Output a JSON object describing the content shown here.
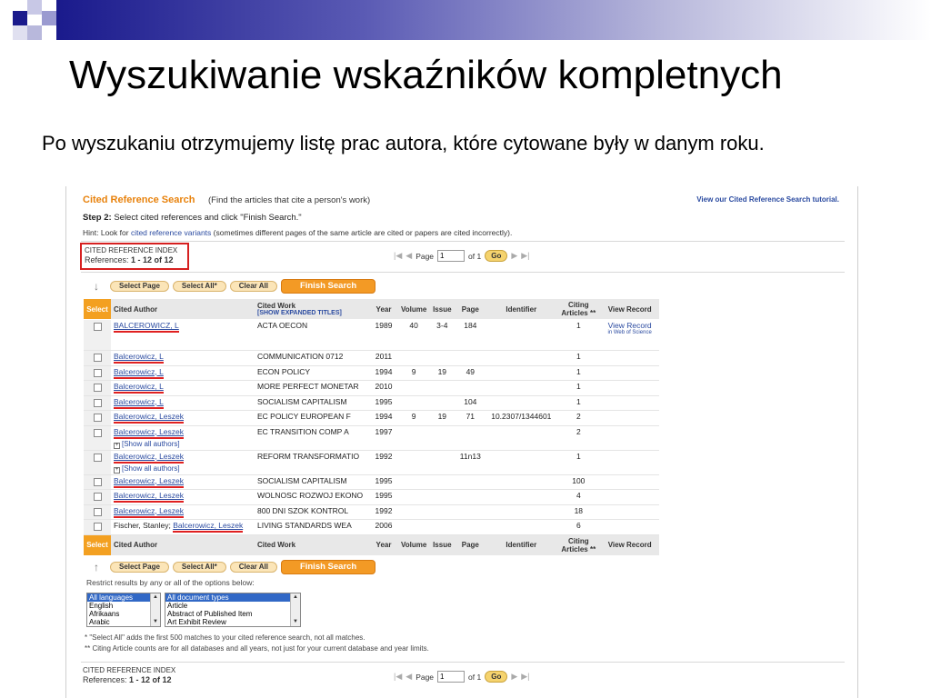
{
  "slide": {
    "title": "Wyszukiwanie wskaźników kompletnych",
    "text": "Po wyszukaniu otrzymujemy listę prac autora, które cytowane były w danym roku."
  },
  "colors": {
    "accent": "#f39a25",
    "highlight": "#e02020",
    "link": "#2a4aa0",
    "banner": "#1a1a8c"
  },
  "header": {
    "title": "Cited Reference Search",
    "subtitle": "(Find the articles that cite a person's work)",
    "tutorial": "View our Cited Reference Search tutorial.",
    "step_label": "Step 2:",
    "step_text": "Select cited references and click \"Finish Search.\"",
    "hint_prefix": "Hint: Look for",
    "hint_link": "cited reference variants",
    "hint_suffix": "(sometimes different pages of the same article are cited or papers are cited incorrectly)."
  },
  "index": {
    "label": "CITED REFERENCE INDEX",
    "refs_label": "References:",
    "refs_value": "1 - 12 of   12"
  },
  "pager": {
    "page_label": "Page",
    "page_value": "1",
    "of_label": "of 1",
    "go": "Go",
    "first": "|◀",
    "prev": "◀",
    "next": "▶",
    "last": "▶|"
  },
  "buttons": {
    "select_page": "Select Page",
    "select_all": "Select All*",
    "clear_all": "Clear All",
    "finish": "Finish Search"
  },
  "table": {
    "headers": {
      "select": "Select",
      "author": "Cited Author",
      "work": "Cited Work",
      "expand": "[SHOW EXPANDED TITLES]",
      "year": "Year",
      "volume": "Volume",
      "issue": "Issue",
      "page": "Page",
      "identifier": "Identifier",
      "citing": "Citing Articles **",
      "view": "View Record"
    },
    "rows": [
      {
        "author": "BALCEROWICZ, L",
        "work": "ACTA OECON",
        "year": "1989",
        "volume": "40",
        "issue": "3-4",
        "page": "184",
        "identifier": "",
        "citing": "1",
        "view": "View Record",
        "view_sub": "in Web of Science",
        "show_all": ""
      },
      {
        "author": "Balcerowicz, L",
        "work": "COMMUNICATION 0712",
        "year": "2011",
        "volume": "",
        "issue": "",
        "page": "",
        "identifier": "",
        "citing": "1",
        "view": "",
        "view_sub": "",
        "show_all": ""
      },
      {
        "author": "Balcerowicz, L",
        "work": "ECON POLICY",
        "year": "1994",
        "volume": "9",
        "issue": "19",
        "page": "49",
        "identifier": "",
        "citing": "1",
        "view": "",
        "view_sub": "",
        "show_all": ""
      },
      {
        "author": "Balcerowicz, L",
        "work": "MORE PERFECT MONETAR",
        "year": "2010",
        "volume": "",
        "issue": "",
        "page": "",
        "identifier": "",
        "citing": "1",
        "view": "",
        "view_sub": "",
        "show_all": ""
      },
      {
        "author": "Balcerowicz, L",
        "work": "SOCIALISM CAPITALISM",
        "year": "1995",
        "volume": "",
        "issue": "",
        "page": "104",
        "identifier": "",
        "citing": "1",
        "view": "",
        "view_sub": "",
        "show_all": ""
      },
      {
        "author": "Balcerowicz, Leszek",
        "work": "EC POLICY EUROPEAN F",
        "year": "1994",
        "volume": "9",
        "issue": "19",
        "page": "71",
        "identifier": "10.2307/1344601",
        "citing": "2",
        "view": "",
        "view_sub": "",
        "show_all": ""
      },
      {
        "author": "Balcerowicz, Leszek",
        "work": "EC TRANSITION COMP A",
        "year": "1997",
        "volume": "",
        "issue": "",
        "page": "",
        "identifier": "",
        "citing": "2",
        "view": "",
        "view_sub": "",
        "show_all": "[Show all authors]"
      },
      {
        "author": "Balcerowicz, Leszek",
        "work": "REFORM TRANSFORMATIO",
        "year": "1992",
        "volume": "",
        "issue": "",
        "page": "11n13",
        "identifier": "",
        "citing": "1",
        "view": "",
        "view_sub": "",
        "show_all": "[Show all authors]"
      },
      {
        "author": "Balcerowicz, Leszek",
        "work": "SOCIALISM CAPITALISM",
        "year": "1995",
        "volume": "",
        "issue": "",
        "page": "",
        "identifier": "",
        "citing": "100",
        "view": "",
        "view_sub": "",
        "show_all": ""
      },
      {
        "author": "Balcerowicz, Leszek",
        "work": "WOLNOSC ROZWOJ EKONO",
        "year": "1995",
        "volume": "",
        "issue": "",
        "page": "",
        "identifier": "",
        "citing": "4",
        "view": "",
        "view_sub": "",
        "show_all": ""
      },
      {
        "author": "Balcerowicz, Leszek",
        "work": "800 DNI SZOK KONTROL",
        "year": "1992",
        "volume": "",
        "issue": "",
        "page": "",
        "identifier": "",
        "citing": "18",
        "view": "",
        "view_sub": "",
        "show_all": ""
      },
      {
        "author_prefix": "Fischer, Stanley;",
        "author": "Balcerowicz, Leszek",
        "work": "LIVING STANDARDS WEA",
        "year": "2006",
        "volume": "",
        "issue": "",
        "page": "",
        "identifier": "",
        "citing": "6",
        "view": "",
        "view_sub": "",
        "show_all": ""
      }
    ]
  },
  "restrict": {
    "label": "Restrict results by any or all of the options below:",
    "languages": [
      "All languages",
      "English",
      "Afrikaans",
      "Arabic"
    ],
    "doc_types": [
      "All document types",
      "Article",
      "Abstract of Published Item",
      "Art Exhibit Review"
    ]
  },
  "notes": {
    "n1": "* \"Select All\" adds the first 500 matches to your cited reference search, not all matches.",
    "n2": "** Citing Article counts are for all databases and all years, not just for your current database and year limits."
  }
}
